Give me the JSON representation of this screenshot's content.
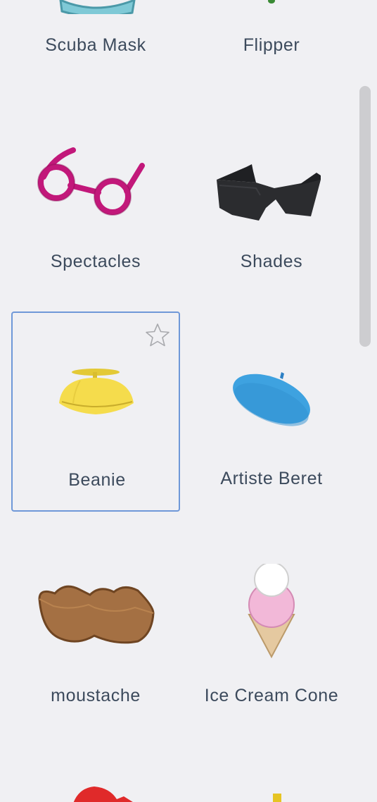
{
  "items": [
    {
      "id": "scuba",
      "label": "Scuba Mask"
    },
    {
      "id": "flipper",
      "label": "Flipper"
    },
    {
      "id": "spectacles",
      "label": "Spectacles"
    },
    {
      "id": "shades",
      "label": "Shades"
    },
    {
      "id": "beanie",
      "label": "Beanie",
      "selected": true
    },
    {
      "id": "beret",
      "label": "Artiste Beret"
    },
    {
      "id": "moustache",
      "label": "moustache"
    },
    {
      "id": "icecream",
      "label": "Ice Cream Cone"
    }
  ],
  "colors": {
    "background": "#f0f0f3",
    "label_text": "#3c4a5c",
    "selection_border": "#6f98d8",
    "scrollbar_thumb": "#cdcdd0"
  },
  "icons": {
    "favorite": "star-outline-icon"
  }
}
